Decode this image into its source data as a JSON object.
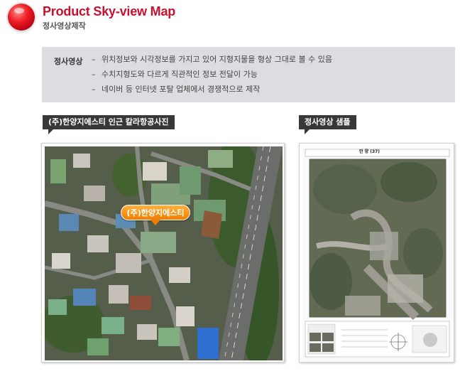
{
  "header": {
    "title": "Product Sky-view Map",
    "subtitle": "정사영상제작"
  },
  "description": {
    "label": "정사영상",
    "items": [
      "위치정보와 시각정보를 가지고 있어 지형지물을 형상 그대로 볼 수 있음",
      "수치지형도와 다르게 직관적인 정보 전달이 가능",
      "네이버 등 인터넷 포탈 업체에서 경쟁적으로 제작"
    ]
  },
  "left_panel": {
    "tag": "(주)한양지에스티 인근 칼라항공사진",
    "callout": "(주)한양지에스티"
  },
  "right_panel": {
    "tag": "정사영상 샘플",
    "map_sheet_title": "안 양 (37)"
  },
  "colors": {
    "accent_red": "#c8102e",
    "callout_orange": "#f07d00",
    "tag_background": "#383838",
    "description_background": "#dcdde1"
  },
  "icons": {
    "header_bullet": "red-sphere-icon"
  }
}
